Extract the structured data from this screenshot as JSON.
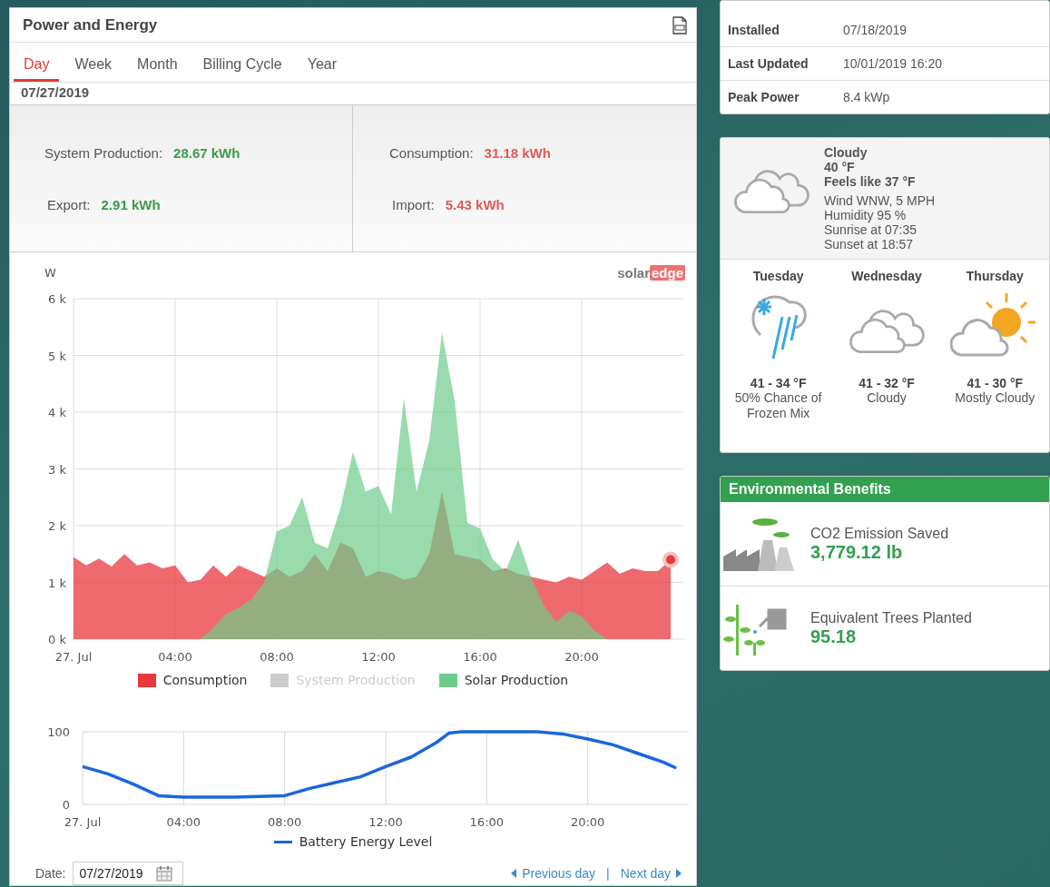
{
  "power_energy": {
    "title": "Power and Energy",
    "tabs": [
      {
        "label": "Day",
        "selected": true
      },
      {
        "label": "Week",
        "selected": false
      },
      {
        "label": "Month",
        "selected": false
      },
      {
        "label": "Billing Cycle",
        "selected": false
      },
      {
        "label": "Year",
        "selected": false
      }
    ],
    "date": "07/27/2019",
    "summary": [
      {
        "label": "System Production:",
        "value": "28.67 kWh",
        "color": "#3a9a4a"
      },
      {
        "label": "Consumption:",
        "value": "31.18 kWh",
        "color": "#e05a5a"
      },
      {
        "label": "Export:",
        "value": "2.91 kWh",
        "color": "#3a9a4a"
      },
      {
        "label": "Import:",
        "value": "5.43 kWh",
        "color": "#e05a5a"
      }
    ],
    "chart": {
      "brand": {
        "first": "solar",
        "second": "edge"
      },
      "chart_data": {
        "type": "area",
        "ylabel": "W",
        "xlim": [
          0,
          24
        ],
        "ylim": [
          0,
          6000
        ],
        "grid": true,
        "legend": "bottom",
        "x": [
          0,
          0.5,
          1,
          1.5,
          2,
          2.5,
          3,
          3.5,
          4,
          4.5,
          5,
          5.5,
          6,
          6.5,
          7,
          7.5,
          8,
          8.5,
          9,
          9.5,
          10,
          10.5,
          11,
          11.5,
          12,
          12.5,
          13,
          13.5,
          14,
          14.5,
          15,
          15.5,
          16,
          16.5,
          17,
          17.5,
          18,
          18.5,
          19,
          19.5,
          20,
          20.5,
          21,
          21.5,
          22,
          22.5,
          23,
          23.5
        ],
        "xticks": [
          {
            "value": 0,
            "label": "27. Jul"
          },
          {
            "value": 4,
            "label": "04:00"
          },
          {
            "value": 8,
            "label": "08:00"
          },
          {
            "value": 12,
            "label": "12:00"
          },
          {
            "value": 16,
            "label": "16:00"
          },
          {
            "value": 20,
            "label": "20:00"
          }
        ],
        "yticks": [
          {
            "value": 0,
            "label": "0 k"
          },
          {
            "value": 1000,
            "label": "1 k"
          },
          {
            "value": 2000,
            "label": "2 k"
          },
          {
            "value": 3000,
            "label": "3 k"
          },
          {
            "value": 4000,
            "label": "4 k"
          },
          {
            "value": 5000,
            "label": "5 k"
          },
          {
            "value": 6000,
            "label": "6 k"
          }
        ],
        "series": [
          {
            "name": "Consumption",
            "color": "#e8383d",
            "values": [
              1450,
              1300,
              1420,
              1280,
              1500,
              1300,
              1350,
              1250,
              1300,
              1000,
              1050,
              1300,
              1100,
              1300,
              1200,
              1100,
              1250,
              1100,
              1200,
              1500,
              1200,
              1700,
              1600,
              1100,
              1200,
              1150,
              1050,
              1100,
              1500,
              2600,
              1500,
              1450,
              1400,
              1200,
              1250,
              1150,
              1100,
              1050,
              1000,
              1100,
              1050,
              1200,
              1350,
              1150,
              1250,
              1200,
              1200,
              1400
            ]
          },
          {
            "name": "System Production",
            "color": "#cccccc",
            "values": [
              null,
              null,
              null,
              null,
              null,
              null,
              null,
              null,
              null,
              null,
              null,
              null,
              null,
              null,
              null,
              null,
              null,
              null,
              null,
              null,
              null,
              null,
              null,
              null,
              null,
              null,
              null,
              null,
              null,
              null,
              null,
              null,
              null,
              null,
              null,
              null,
              null,
              null,
              null,
              null,
              null,
              null,
              null,
              null,
              null,
              null,
              null,
              null
            ]
          },
          {
            "name": "Solar Production",
            "color": "#6dcc8a",
            "values": [
              0,
              0,
              0,
              0,
              0,
              0,
              0,
              0,
              0,
              0,
              0,
              200,
              450,
              550,
              700,
              1000,
              1900,
              2000,
              2500,
              1700,
              1600,
              2300,
              3300,
              2600,
              2700,
              2200,
              4250,
              2600,
              3500,
              5400,
              4200,
              2050,
              1950,
              1400,
              1200,
              1750,
              1100,
              600,
              300,
              500,
              400,
              150,
              0,
              0,
              0,
              0,
              0,
              0
            ]
          }
        ]
      }
    },
    "battery_chart": {
      "chart_data": {
        "type": "line",
        "xlim": [
          0,
          24
        ],
        "ylim": [
          0,
          100
        ],
        "grid": true,
        "legend": "bottom",
        "x": [
          0,
          1,
          2,
          3,
          4,
          5,
          6,
          7,
          8,
          9,
          10,
          11,
          12,
          13,
          14,
          14.5,
          15,
          16,
          17,
          18,
          19,
          20,
          21,
          22,
          23,
          23.5
        ],
        "xticks": [
          {
            "value": 0,
            "label": "27. Jul"
          },
          {
            "value": 4,
            "label": "04:00"
          },
          {
            "value": 8,
            "label": "08:00"
          },
          {
            "value": 12,
            "label": "12:00"
          },
          {
            "value": 16,
            "label": "16:00"
          },
          {
            "value": 20,
            "label": "20:00"
          }
        ],
        "yticks": [
          0,
          100
        ],
        "series": [
          {
            "name": "Battery Energy Level",
            "color": "#1a66dd",
            "values": [
              52,
              42,
              28,
              12,
              10,
              10,
              10,
              11,
              12,
              22,
              30,
              38,
              52,
              65,
              85,
              98,
              100,
              100,
              100,
              100,
              97,
              90,
              82,
              70,
              58,
              50
            ]
          }
        ]
      }
    },
    "footer": {
      "date_label": "Date:",
      "date_value": "07/27/2019",
      "previous": "Previous day",
      "separator": "|",
      "next": "Next day"
    }
  },
  "site_info": {
    "rows": [
      {
        "label": "Installed",
        "value": "07/18/2019"
      },
      {
        "label": "Last Updated",
        "value": "10/01/2019 16:20"
      },
      {
        "label": "Peak Power",
        "value": "8.4 kWp"
      }
    ]
  },
  "weather": {
    "current": {
      "condition": "Cloudy",
      "temperature": "40 °F",
      "feels_like": "Feels like 37 °F",
      "details": [
        "Wind WNW, 5 MPH",
        "Humidity 95 %",
        "Sunrise at 07:35",
        "Sunset at 18:57"
      ]
    },
    "forecast": [
      {
        "day": "Tuesday",
        "kind": "snow",
        "range": "41 - 34 °F",
        "description": "50% Chance of Frozen Mix"
      },
      {
        "day": "Wednesday",
        "kind": "cloudy",
        "range": "41 - 32 °F",
        "description": "Cloudy"
      },
      {
        "day": "Thursday",
        "kind": "partly-sunny",
        "range": "41 - 30 °F",
        "description": "Mostly Cloudy"
      }
    ]
  },
  "environmental_benefits": {
    "title": "Environmental Benefits",
    "items": [
      {
        "kind": "co2",
        "label": "CO2 Emission Saved",
        "value": "3,779.12 lb"
      },
      {
        "kind": "trees",
        "label": "Equivalent Trees Planted",
        "value": "95.18"
      }
    ]
  }
}
